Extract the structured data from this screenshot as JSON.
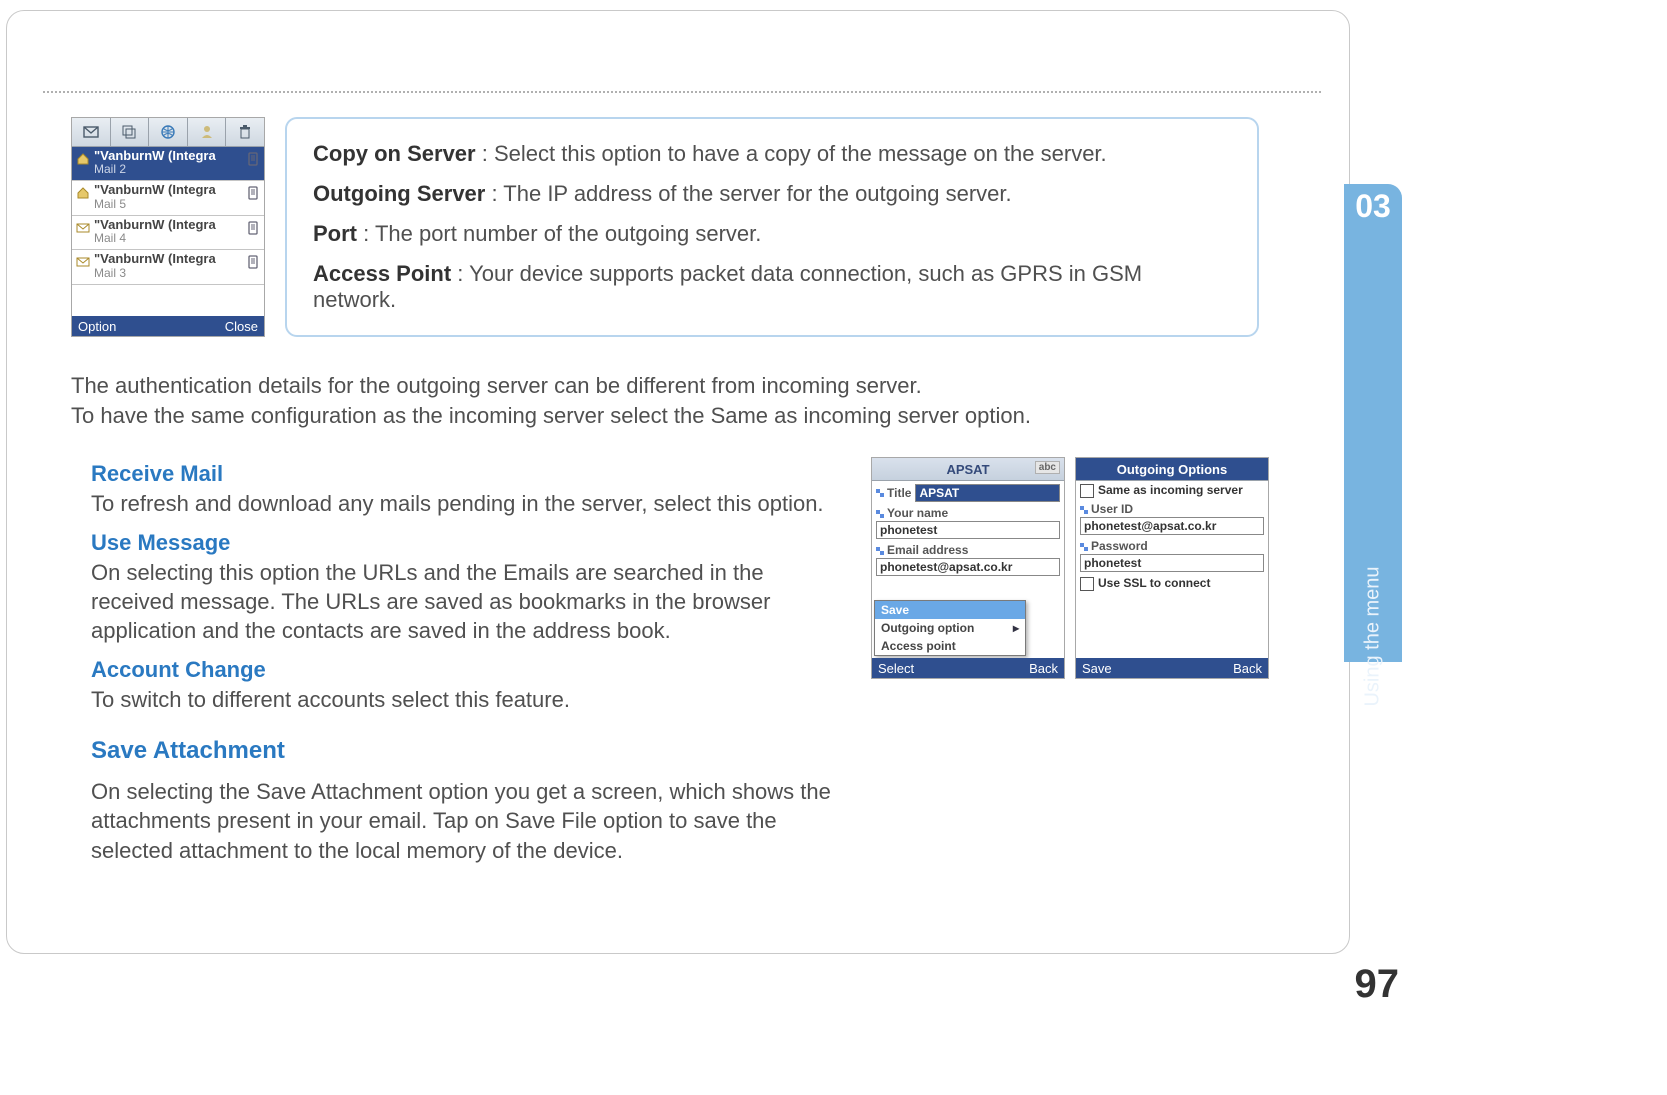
{
  "sideTab": {
    "number": "03",
    "label": "Using the menu"
  },
  "pageNumber": "97",
  "callout": [
    {
      "term": "Copy on Server",
      "desc": " : Select this option to have a copy of the message on the server."
    },
    {
      "term": "Outgoing Server",
      "desc": " : The IP address of the server for the outgoing server."
    },
    {
      "term": "Port",
      "desc": " : The port number of the outgoing server."
    },
    {
      "term": "Access Point",
      "desc": " : Your device supports packet data connection, such as GPRS in GSM network."
    }
  ],
  "authPara": "The authentication details for the outgoing server can be different from incoming server.\nTo have the same configuration as the incoming server select the Same as incoming server option.",
  "features": [
    {
      "h": "Receive Mail",
      "p": "To refresh and download any mails pending in the server, select this option."
    },
    {
      "h": "Use Message",
      "p": "On selecting this option the URLs and the Emails are searched in the received message. The URLs are saved as bookmarks in the browser application and the contacts are saved in the address book."
    },
    {
      "h": "Account Change",
      "p": "To switch to different accounts select this feature."
    }
  ],
  "saveAttachment": {
    "h": "Save Attachment",
    "p": "On selecting the Save Attachment option you get a screen, which shows the attachments present in your email. Tap on Save File option to save the selected attachment to the local memory of the device."
  },
  "inboxPhone": {
    "items": [
      {
        "sender": "\"VanburnW (Integra",
        "sub": "Mail 2",
        "active": true,
        "icon": "home"
      },
      {
        "sender": "\"VanburnW (Integra",
        "sub": "Mail  5",
        "active": false,
        "icon": "home"
      },
      {
        "sender": "\"VanburnW (Integra",
        "sub": "Mail 4",
        "active": false,
        "icon": "mail"
      },
      {
        "sender": "\"VanburnW (Integra",
        "sub": "Mail 3",
        "active": false,
        "icon": "mail"
      }
    ],
    "softkeys": {
      "left": "Option",
      "right": "Close"
    }
  },
  "apsatPhone": {
    "title": "APSAT",
    "inputMode": "abc",
    "rows": [
      {
        "label": "Title",
        "value": "APSAT",
        "selected": true,
        "inline": true
      },
      {
        "label": "Your name",
        "value": "phonetest",
        "selected": false
      },
      {
        "label": "Email address",
        "value": "phonetest@apsat.co.kr",
        "selected": false
      }
    ],
    "menu": [
      {
        "label": "Save",
        "selected": true
      },
      {
        "label": "Outgoing option",
        "selected": false,
        "arrow": true
      },
      {
        "label": "Access point",
        "selected": false
      }
    ],
    "softkeys": {
      "left": "Select",
      "right": "Back"
    }
  },
  "outgoingPhone": {
    "title": "Outgoing Options",
    "checks": [
      {
        "label": "Same as incoming server"
      }
    ],
    "rows": [
      {
        "label": "User ID",
        "value": "phonetest@apsat.co.kr"
      },
      {
        "label": "Password",
        "value": "phonetest"
      }
    ],
    "checks2": [
      {
        "label": "Use SSL to connect"
      }
    ],
    "softkeys": {
      "left": "Save",
      "right": "Back"
    }
  }
}
